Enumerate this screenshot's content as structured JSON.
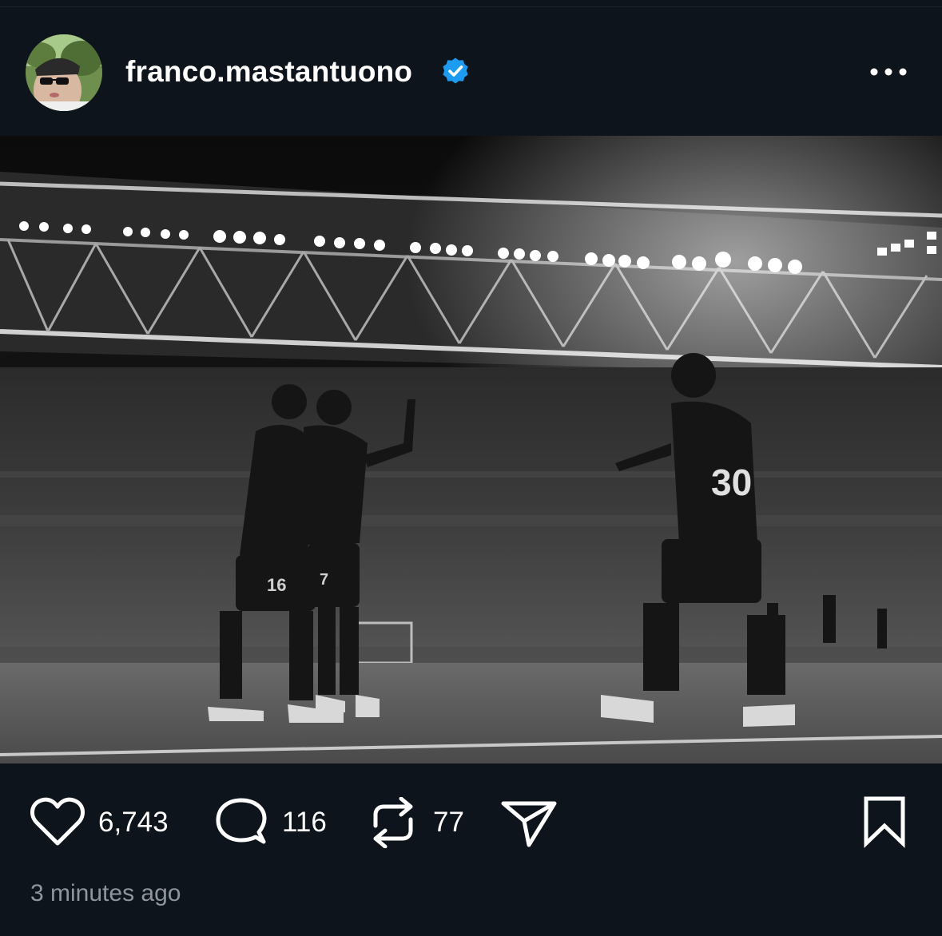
{
  "post": {
    "username": "franco.mastantuono",
    "verified_icon": "verified-badge-icon",
    "more_icon": "more-options-icon",
    "timestamp": "3 minutes ago"
  },
  "actions": {
    "likes": "6,743",
    "comments": "116",
    "reposts": "77",
    "icons": [
      "heart-icon",
      "comment-icon",
      "repost-icon",
      "share-icon",
      "bookmark-icon"
    ]
  },
  "photo": {
    "jersey_numbers": [
      "16",
      "7",
      "30"
    ]
  },
  "colors": {
    "background": "#0e141b",
    "verified": "#1d9bf0",
    "timestamp": "#8e959c"
  }
}
